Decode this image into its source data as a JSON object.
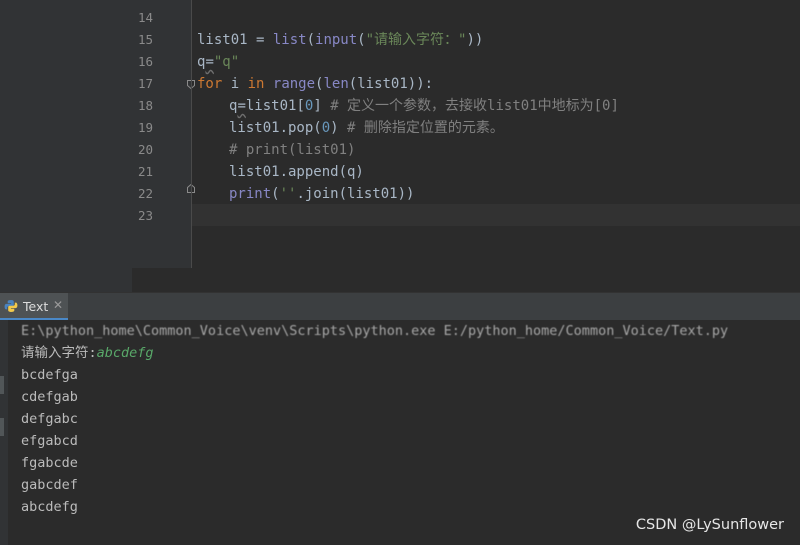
{
  "editor": {
    "line_numbers": [
      "14",
      "15",
      "16",
      "17",
      "18",
      "19",
      "20",
      "21",
      "22",
      "23"
    ],
    "code": {
      "l15": {
        "var": "list01 = ",
        "fn1": "list",
        "p1": "(",
        "fn2": "input",
        "p2": "(",
        "str": "\"请输入字符：\"",
        "p3": "))"
      },
      "l16": {
        "q": "q",
        "eq": "=",
        "str": "\"q\""
      },
      "l17": {
        "kw": "for",
        "mid": " i ",
        "in": "in",
        "sp": " ",
        "range": "range",
        "p1": "(",
        "len": "len",
        "rest": "(list01)):"
      },
      "l18": {
        "q": "q",
        "eq": "=",
        "a": "list01[",
        "n": "0",
        "b": "]",
        "comment": " # 定义一个参数，去接收list01中地标为[0]"
      },
      "l19": {
        "a": "list01.pop(",
        "n": "0",
        "b": ")",
        "comment": " # 删除指定位置的元素。"
      },
      "l20": {
        "comment": "# print(list01)"
      },
      "l21": {
        "text": "list01.append(q)"
      },
      "l22": {
        "fn": "print",
        "p": "(",
        "str": "''",
        "rest": ".join(list01))"
      }
    }
  },
  "run": {
    "tab_label": "Text",
    "close_glyph": "✕",
    "output": {
      "path": "E:\\python_home\\Common_Voice\\venv\\Scripts\\python.exe E:/python_home/Common_Voice/Text.py",
      "prompt": "请输入字符:",
      "input_value": "abcdefg",
      "lines": [
        "bcdefga",
        "cdefgab",
        "defgabc",
        "efgabcd",
        "fgabcde",
        "gabcdef",
        "abcdefg"
      ]
    }
  },
  "watermark": "CSDN @LySunflower"
}
